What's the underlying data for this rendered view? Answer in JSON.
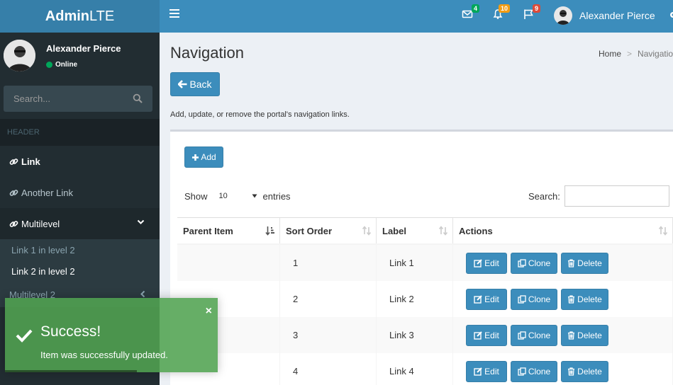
{
  "brand": {
    "bold": "Admin",
    "light": "LTE"
  },
  "navbar": {
    "messages_count": "4",
    "notifications_count": "10",
    "tasks_count": "9",
    "user_name": "Alexander Pierce",
    "colors": {
      "messages_badge": "#00a65a",
      "notifications_badge": "#f39c12",
      "tasks_badge": "#dd4b39"
    }
  },
  "sidebar": {
    "user_name": "Alexander Pierce",
    "status": "Online",
    "search_placeholder": "Search...",
    "header": "HEADER",
    "items": [
      {
        "label": "Link"
      },
      {
        "label": "Another Link"
      },
      {
        "label": "Multilevel"
      }
    ],
    "submenu": [
      {
        "label": "Link 1 in level 2"
      },
      {
        "label": "Link 2 in level 2"
      }
    ],
    "multilevel2": "Multilevel 2"
  },
  "page": {
    "title": "Navigation",
    "breadcrumb_home": "Home",
    "breadcrumb_current": "Navigation",
    "back_label": "Back",
    "description": "Add, update, or remove the portal's navigation links."
  },
  "table": {
    "add_label": "Add",
    "show_label": "Show",
    "page_size": "10",
    "entries_label": "entries",
    "search_label": "Search:",
    "columns": [
      "Parent Item",
      "Sort Order",
      "Label",
      "Actions"
    ],
    "rows": [
      {
        "parent": "",
        "order": "1",
        "label": "Link 1"
      },
      {
        "parent": "",
        "order": "2",
        "label": "Link 2"
      },
      {
        "parent": "",
        "order": "3",
        "label": "Link 3"
      },
      {
        "parent": "",
        "order": "4",
        "label": "Link 4"
      }
    ],
    "actions": {
      "edit": "Edit",
      "clone": "Clone",
      "delete": "Delete"
    }
  },
  "toast": {
    "title": "Success!",
    "message": "Item was successfully updated.",
    "close": "×"
  }
}
